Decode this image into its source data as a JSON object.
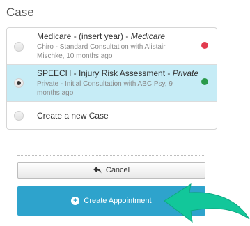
{
  "section": {
    "title": "Case"
  },
  "cases": [
    {
      "title": "Medicare - (insert year) - ",
      "type": "Medicare",
      "sub": "Chiro - Standard Consultation with Alistair Mischke, 10 months ago",
      "status_color": "#e23b4e",
      "selected": false
    },
    {
      "title": "SPEECH - Injury Risk Assessment - ",
      "type": "Private",
      "sub": "Private - Initial Consultation with ABC Psy, 9 months ago",
      "status_color": "#2a9a4a",
      "selected": true
    },
    {
      "title": "Create a new Case",
      "selected": false
    }
  ],
  "buttons": {
    "cancel_label": "Cancel",
    "create_label": "Create Appointment"
  },
  "colors": {
    "selected_row": "#c6ecf6",
    "primary": "#2ea3cc",
    "arrow": "#12c79a"
  }
}
